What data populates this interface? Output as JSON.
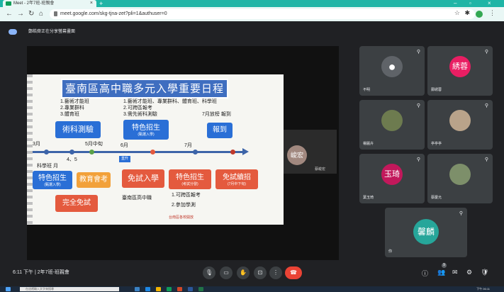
{
  "browser": {
    "tab_title": "Meet - 2年7班-班親會",
    "tab_close": "×",
    "new_tab": "+",
    "url": "meet.google.com/skg-tjna-zet?pli=1&authuser=0",
    "win_min": "–",
    "win_max": "▫",
    "win_close": "×"
  },
  "meet": {
    "presenting_label": "鄭皓齊正在分享螢幕畫面",
    "time_label": "6:11 下午",
    "meeting_name": "2年7班-班親會",
    "participant_count": "9"
  },
  "slide": {
    "title": "臺南區高中職多元入學重要日程表",
    "note_top_left": [
      "1.藝術才能班",
      "2.專業群科",
      "3.體育班"
    ],
    "note_top_mid": [
      "1.藝術才能班、專業群科、體育班、科學班",
      "2.可跨區報考",
      "3.需先術科測驗"
    ],
    "note_result": "7月放榜  報到",
    "month_3": "3月",
    "month_45": "4、5",
    "month_5": "5月中旬",
    "month_6": "6月",
    "month_7": "7月",
    "science_class": "科學班  月",
    "boxes": {
      "arts_test": "術科測驗",
      "special_recruit_top": "特色招生",
      "special_recruit_top_sub": "(甄選入學)",
      "enroll": "報到",
      "special_recruit_left": "特色招生",
      "special_recruit_left_sub": "(甄選入學)",
      "education_exam": "教育會考",
      "free_admission": "免試入學",
      "special_recruit_exam": "特色招生",
      "special_recruit_exam_sub": "(考試分發)",
      "free_continue": "免試續招",
      "free_continue_sub": "(7月中下旬)",
      "fully_free": "完全免試"
    },
    "bottom_note_a": "臺南區高中職",
    "bottom_note_b": [
      "1.可跨區報考",
      "2.參加學測"
    ],
    "bottom_small": "台南區各校開放",
    "label_june": "直升"
  },
  "speaker_tile": {
    "avatar": "峻宏",
    "name": "蔡峻宏"
  },
  "participants": [
    {
      "name": "不明",
      "avatar": "",
      "color": "#5f6368"
    },
    {
      "name": "鄭綉蓉",
      "avatar": "綉蓉",
      "color": "#e91e63"
    },
    {
      "name": "楊麗卉",
      "avatar": "",
      "color": "#6d7b4f"
    },
    {
      "name": "亭亭亭",
      "avatar": "",
      "color": "#b9a38a"
    },
    {
      "name": "葉玉琦",
      "avatar": "玉琦",
      "color": "#c2185b"
    },
    {
      "name": "蔡慶允",
      "avatar": "",
      "color": "#7d8f6a"
    },
    {
      "name": "你",
      "avatar": "馨麟",
      "color": "#26a69a"
    }
  ],
  "icons": {
    "pin": "pin-icon",
    "mic": "mic-icon",
    "camera": "camera-icon",
    "hand": "raise-hand-icon",
    "present": "present-icon",
    "more": "more-options-icon",
    "end": "end-call-icon"
  },
  "taskbar": {
    "search_placeholder": "在這裡輸入文字來搜尋",
    "clock": "下午 06:11"
  },
  "colors": {
    "tab_bar": "#1fb5a6",
    "meet_bg": "#202124",
    "end_call": "#ea4335",
    "accent": "#8ab4f8"
  }
}
